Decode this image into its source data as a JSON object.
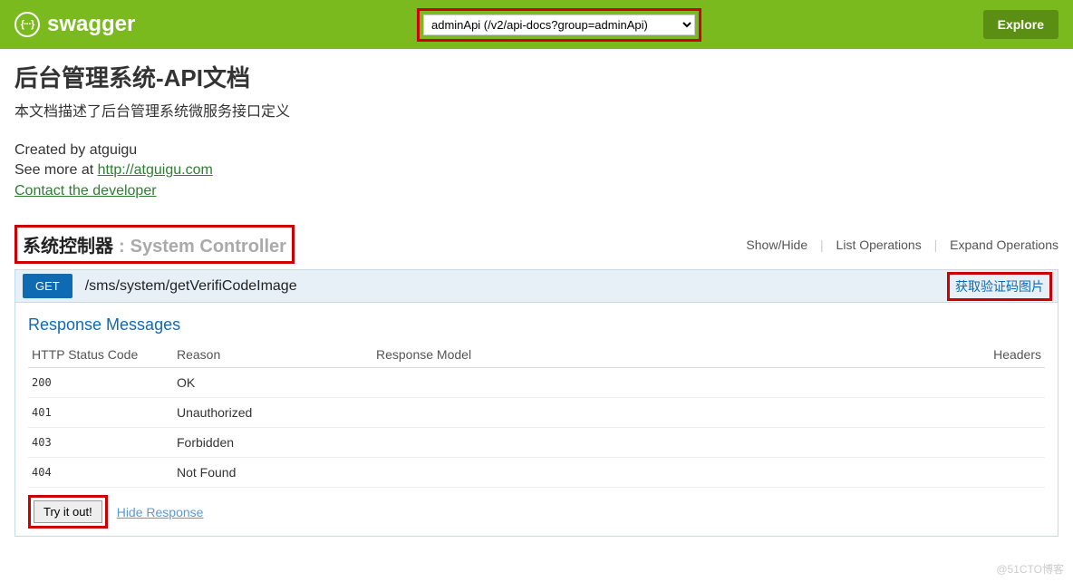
{
  "header": {
    "logo_glyph": "{···}",
    "logo_text": "swagger",
    "api_select": "adminApi (/v2/api-docs?group=adminApi)",
    "explore_label": "Explore"
  },
  "info": {
    "title": "后台管理系统-API文档",
    "description": "本文档描述了后台管理系统微服务接口定义",
    "created_by_label": "Created by atguigu",
    "see_more_label": "See more at ",
    "see_more_link": "http://atguigu.com",
    "contact_label": "Contact the developer"
  },
  "controller": {
    "name_cn": "系统控制器",
    "separator": ":",
    "name_en": "System Controller",
    "actions": {
      "show_hide": "Show/Hide",
      "list_ops": "List Operations",
      "expand_ops": "Expand Operations"
    }
  },
  "operation": {
    "method": "GET",
    "path": "/sms/system/getVerifiCodeImage",
    "summary": "获取验证码图片"
  },
  "responses": {
    "title": "Response Messages",
    "columns": {
      "code": "HTTP Status Code",
      "reason": "Reason",
      "model": "Response Model",
      "headers": "Headers"
    },
    "rows": [
      {
        "code": "200",
        "reason": "OK"
      },
      {
        "code": "401",
        "reason": "Unauthorized"
      },
      {
        "code": "403",
        "reason": "Forbidden"
      },
      {
        "code": "404",
        "reason": "Not Found"
      }
    ]
  },
  "actions": {
    "try_it_out": "Try it out!",
    "hide_response": "Hide Response"
  },
  "watermark": "@51CTO博客"
}
